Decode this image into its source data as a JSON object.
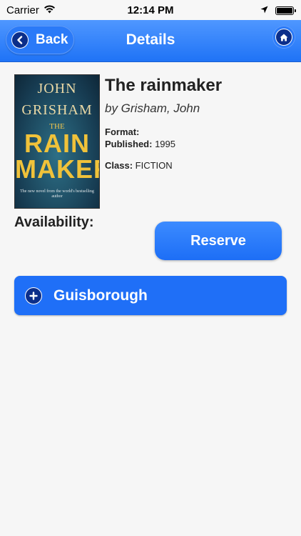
{
  "status_bar": {
    "carrier": "Carrier",
    "time": "12:14 PM",
    "battery_level": 1.0
  },
  "nav": {
    "back_label": "Back",
    "title": "Details",
    "icons": {
      "back": "chevron-left-icon",
      "home": "home-icon"
    }
  },
  "book": {
    "cover": {
      "author_line1": "JOHN",
      "author_line2": "GRISHAM",
      "the": "THE",
      "title_line1": "RAIN",
      "title_line2": "MAKER",
      "blurb": "The new novel from the world's bestselling author"
    },
    "title": "The rainmaker",
    "byline": "by Grisham, John",
    "format_label": "Format:",
    "format_value": "",
    "published_label": "Published:",
    "published_value": "1995",
    "class_label": "Class:",
    "class_value": "FICTION"
  },
  "availability": {
    "label": "Availability:",
    "reserve_label": "Reserve",
    "branches": [
      {
        "name": "Guisborough",
        "icon": "plus-icon"
      }
    ]
  },
  "colors": {
    "nav_blue": "#1f73f6",
    "button_blue": "#1d6ef6",
    "icon_navy": "#0b2e8a"
  }
}
